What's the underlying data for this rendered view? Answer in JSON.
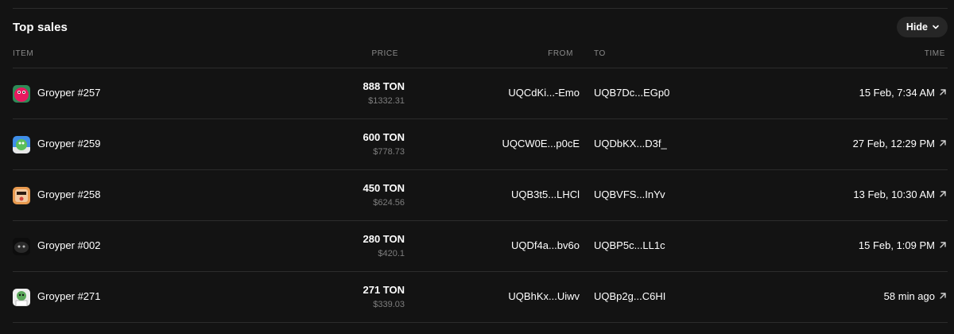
{
  "section": {
    "title": "Top sales",
    "hide_label": "Hide"
  },
  "columns": {
    "item": "ITEM",
    "price": "PRICE",
    "from": "FROM",
    "to": "TO",
    "time": "TIME"
  },
  "rows": [
    {
      "name": "Groyper #257",
      "price": "888 TON",
      "usd": "$1332.31",
      "from": "UQCdKi...-Emo",
      "to": "UQB7Dc...EGp0",
      "time": "15 Feb, 7:34 AM",
      "avatar_color": "#e8195f"
    },
    {
      "name": "Groyper #259",
      "price": "600 TON",
      "usd": "$778.73",
      "from": "UQCW0E...p0cE",
      "to": "UQDbKX...D3f_",
      "time": "27 Feb, 12:29 PM",
      "avatar_color": "#3f8ee8"
    },
    {
      "name": "Groyper #258",
      "price": "450 TON",
      "usd": "$624.56",
      "from": "UQB3t5...LHCl",
      "to": "UQBVFS...InYv",
      "time": "13 Feb, 10:30 AM",
      "avatar_color": "#e89a4f"
    },
    {
      "name": "Groyper #002",
      "price": "280 TON",
      "usd": "$420.1",
      "from": "UQDf4a...bv6o",
      "to": "UQBP5c...LL1c",
      "time": "15 Feb, 1:09 PM",
      "avatar_color": "#1a1a1a"
    },
    {
      "name": "Groyper #271",
      "price": "271 TON",
      "usd": "$339.03",
      "from": "UQBhKx...Uiwv",
      "to": "UQBp2g...C6HI",
      "time": "58 min ago",
      "avatar_color": "#eeeeee"
    }
  ],
  "icons": {
    "hide_chevron": "chevron-down-icon",
    "row_link": "arrow-up-right-icon"
  }
}
